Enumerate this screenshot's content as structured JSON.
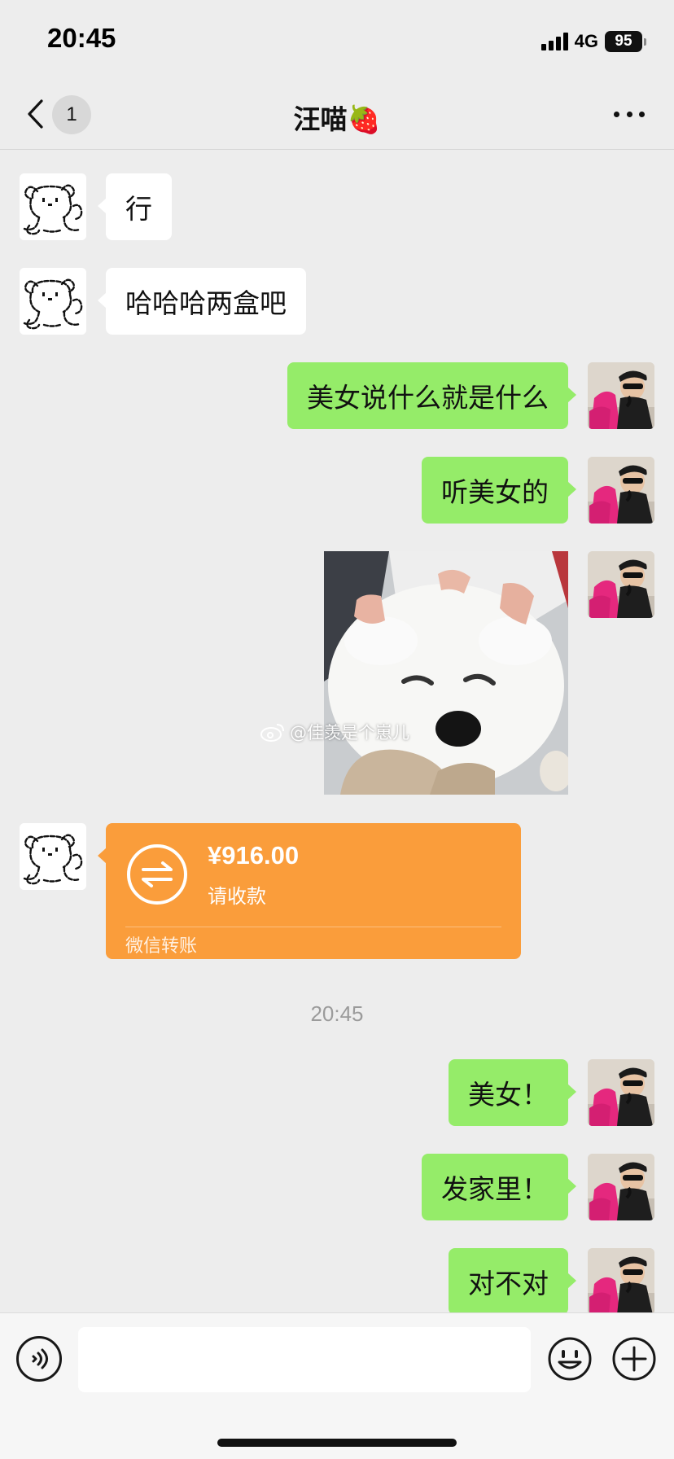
{
  "status_bar": {
    "time": "20:45",
    "network": "4G",
    "battery": "95"
  },
  "header": {
    "back_icon": "chevron-left-icon",
    "unread_count": "1",
    "title": "汪喵🍓",
    "more_icon": "more-dots-icon"
  },
  "messages": [
    {
      "side": "left",
      "type": "text",
      "text": "行"
    },
    {
      "side": "left",
      "type": "text",
      "text": "哈哈哈两盒吧"
    },
    {
      "side": "right",
      "type": "text",
      "text": "美女说什么就是什么"
    },
    {
      "side": "right",
      "type": "text",
      "text": "听美女的"
    },
    {
      "side": "right",
      "type": "image",
      "description": "white fluffy dog"
    },
    {
      "side": "left",
      "type": "transfer",
      "amount": "¥916.00",
      "status": "请收款",
      "footer": "微信转账"
    },
    {
      "side": "right",
      "type": "text",
      "text": "美女！"
    },
    {
      "side": "right",
      "type": "text",
      "text": "发家里！"
    },
    {
      "side": "right",
      "type": "text",
      "text": "对不对"
    }
  ],
  "timestamp": "20:45",
  "watermark": "@佳羡是个崽儿",
  "input_bar": {
    "placeholder": "",
    "voice_icon": "voice-icon",
    "emoji_icon": "emoji-icon",
    "plus_icon": "plus-icon"
  },
  "colors": {
    "background": "#ededed",
    "bubble_self": "#95ec69",
    "bubble_other": "#ffffff",
    "transfer": "#fa9d3b"
  }
}
